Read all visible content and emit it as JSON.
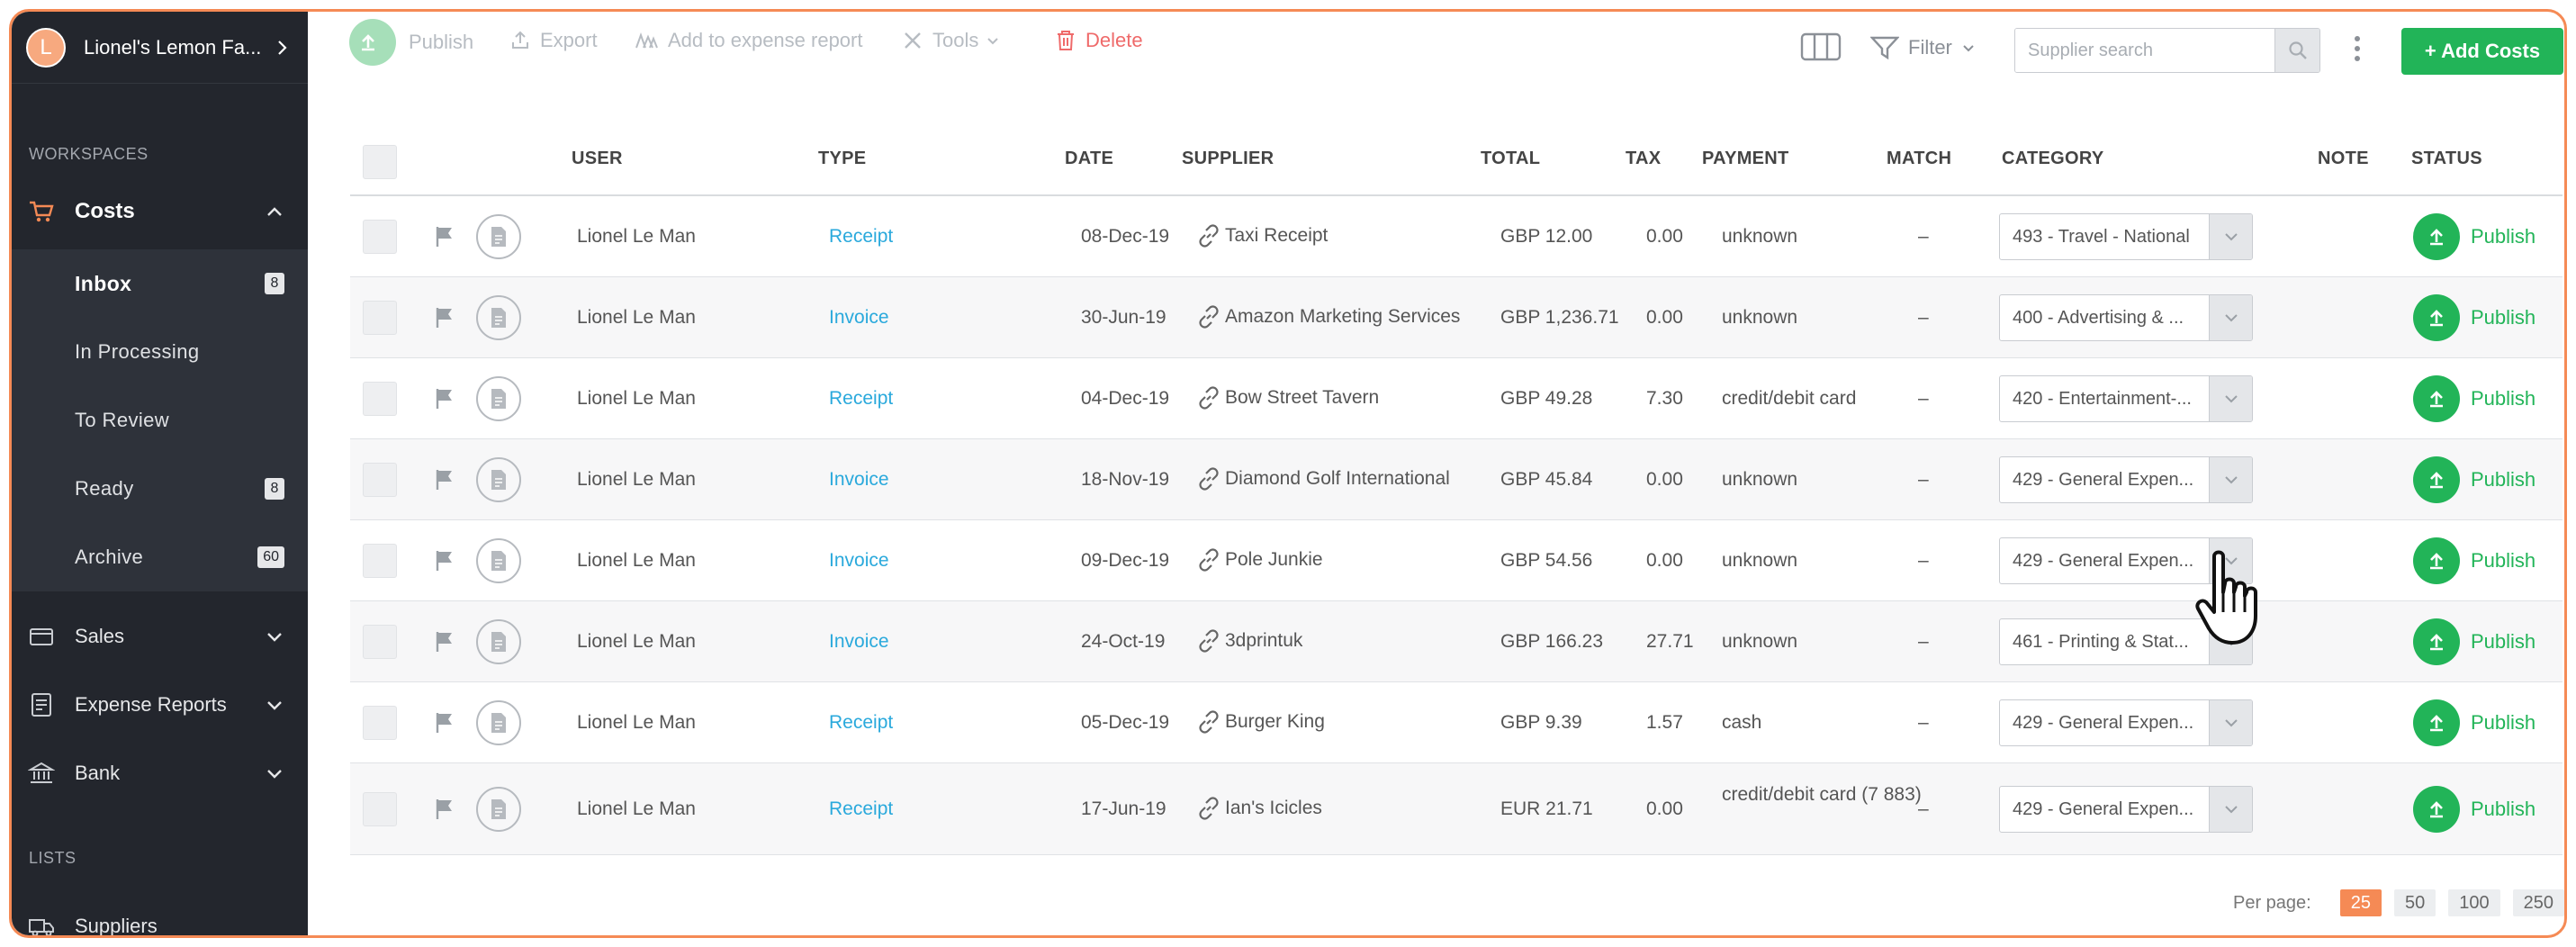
{
  "org": {
    "initial": "L",
    "name": "Lionel's Lemon Fa..."
  },
  "sidebar": {
    "workspaces_label": "WORKSPACES",
    "costs_label": "Costs",
    "sub_items": [
      {
        "label": "Inbox",
        "badge": "8"
      },
      {
        "label": "In Processing",
        "badge": ""
      },
      {
        "label": "To Review",
        "badge": ""
      },
      {
        "label": "Ready",
        "badge": "8"
      },
      {
        "label": "Archive",
        "badge": "60"
      }
    ],
    "sales_label": "Sales",
    "expense_reports_label": "Expense Reports",
    "bank_label": "Bank",
    "lists_label": "LISTS",
    "suppliers_label": "Suppliers"
  },
  "toolbar": {
    "publish": "Publish",
    "export": "Export",
    "add_expense": "Add to expense report",
    "tools": "Tools",
    "delete": "Delete",
    "filter": "Filter",
    "search_placeholder": "Supplier search",
    "add_costs": "+ Add Costs"
  },
  "columns": {
    "user": "USER",
    "type": "TYPE",
    "date": "DATE",
    "supplier": "SUPPLIER",
    "total": "TOTAL",
    "tax": "TAX",
    "payment": "PAYMENT",
    "match": "MATCH",
    "category": "CATEGORY",
    "note": "NOTE",
    "status": "STATUS"
  },
  "rows": [
    {
      "user": "Lionel Le Man",
      "type": "Receipt",
      "date": "08-Dec-19",
      "supplier": "Taxi Receipt",
      "total": "GBP 12.00",
      "tax": "0.00",
      "payment": "unknown",
      "match": "–",
      "category": "493 - Travel - National",
      "status": "Publish"
    },
    {
      "user": "Lionel Le Man",
      "type": "Invoice",
      "date": "30-Jun-19",
      "supplier": "Amazon Marketing Services",
      "total": "GBP 1,236.71",
      "tax": "0.00",
      "payment": "unknown",
      "match": "–",
      "category": "400 - Advertising & ...",
      "status": "Publish"
    },
    {
      "user": "Lionel Le Man",
      "type": "Receipt",
      "date": "04-Dec-19",
      "supplier": "Bow Street Tavern",
      "total": "GBP 49.28",
      "tax": "7.30",
      "payment": "credit/debit card",
      "match": "–",
      "category": "420 - Entertainment-...",
      "status": "Publish"
    },
    {
      "user": "Lionel Le Man",
      "type": "Invoice",
      "date": "18-Nov-19",
      "supplier": "Diamond Golf International",
      "total": "GBP 45.84",
      "tax": "0.00",
      "payment": "unknown",
      "match": "–",
      "category": "429 - General Expen...",
      "status": "Publish"
    },
    {
      "user": "Lionel Le Man",
      "type": "Invoice",
      "date": "09-Dec-19",
      "supplier": "Pole Junkie",
      "total": "GBP 54.56",
      "tax": "0.00",
      "payment": "unknown",
      "match": "–",
      "category": "429 - General Expen...",
      "status": "Publish"
    },
    {
      "user": "Lionel Le Man",
      "type": "Invoice",
      "date": "24-Oct-19",
      "supplier": "3dprintuk",
      "total": "GBP 166.23",
      "tax": "27.71",
      "payment": "unknown",
      "match": "–",
      "category": "461 - Printing & Stat...",
      "status": "Publish"
    },
    {
      "user": "Lionel Le Man",
      "type": "Receipt",
      "date": "05-Dec-19",
      "supplier": "Burger King",
      "total": "GBP 9.39",
      "tax": "1.57",
      "payment": "cash",
      "match": "–",
      "category": "429 - General Expen...",
      "status": "Publish"
    },
    {
      "user": "Lionel Le Man",
      "type": "Receipt",
      "date": "17-Jun-19",
      "supplier": "Ian's Icicles",
      "total": "EUR 21.71",
      "tax": "0.00",
      "payment": "credit/debit card (7 883)",
      "match": "–",
      "category": "429 - General Expen...",
      "status": "Publish"
    }
  ],
  "pagination": {
    "label": "Per page:",
    "options": [
      "25",
      "50",
      "100",
      "250"
    ],
    "selected": "25"
  },
  "colors": {
    "accent": "#f58a55",
    "green": "#22b458",
    "sidebar": "#23262d",
    "link": "#2aa9dc",
    "delete": "#ef6a6a"
  }
}
